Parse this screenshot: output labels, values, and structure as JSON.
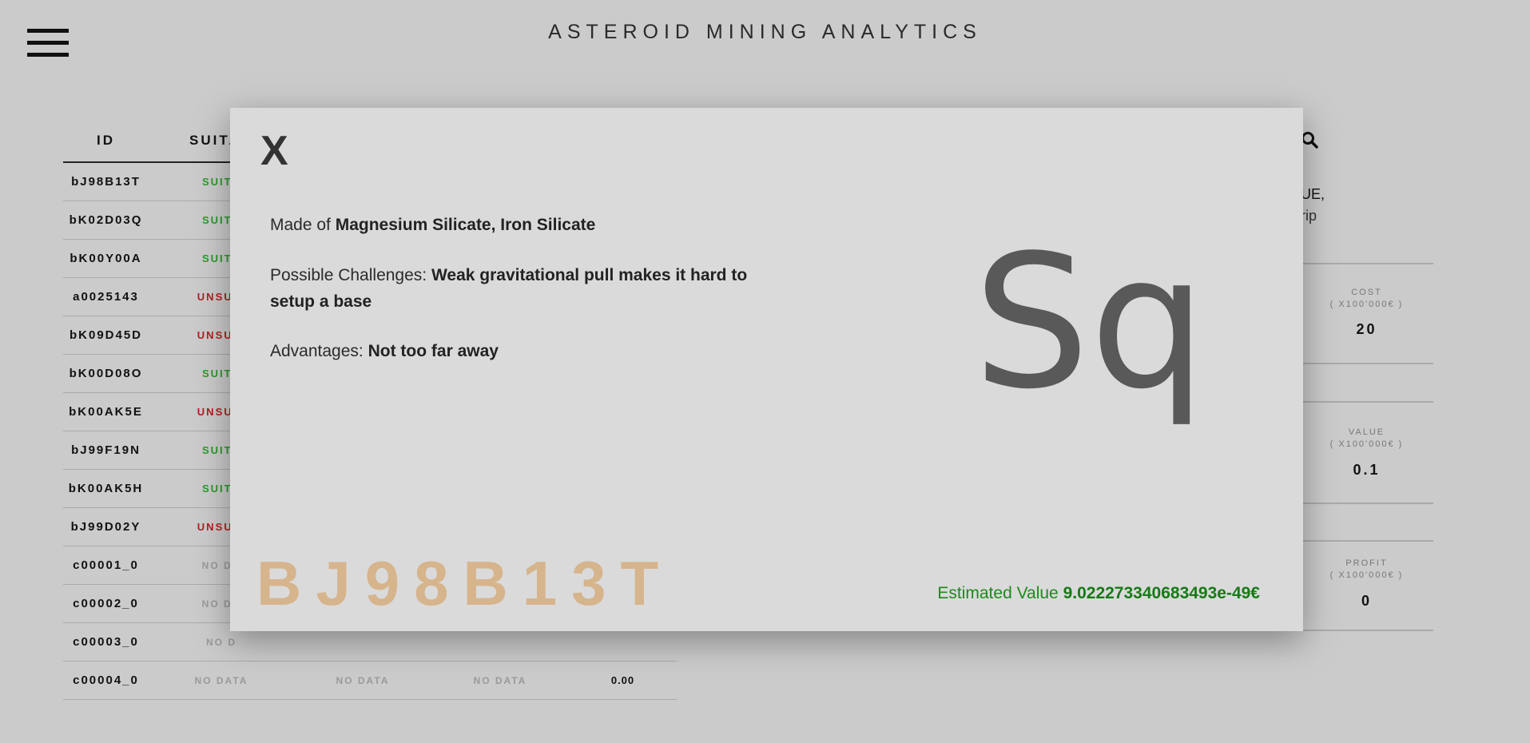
{
  "app": {
    "title": "ASTEROID MINING ANALYTICS"
  },
  "table": {
    "headers": [
      "ID",
      "SUITAB"
    ],
    "rows": [
      {
        "id": "bJ98B13T",
        "status": "SUITA",
        "cls": "s"
      },
      {
        "id": "bK02D03Q",
        "status": "SUITA",
        "cls": "s"
      },
      {
        "id": "bK00Y00A",
        "status": "SUITA",
        "cls": "s"
      },
      {
        "id": "a0025143",
        "status": "UNSUIT",
        "cls": "u"
      },
      {
        "id": "bK09D45D",
        "status": "UNSUIT",
        "cls": "u"
      },
      {
        "id": "bK00D08O",
        "status": "SUITA",
        "cls": "s"
      },
      {
        "id": "bK00AK5E",
        "status": "UNSUIT",
        "cls": "u"
      },
      {
        "id": "bJ99F19N",
        "status": "SUITA",
        "cls": "s"
      },
      {
        "id": "bK00AK5H",
        "status": "SUITA",
        "cls": "s"
      },
      {
        "id": "bJ99D02Y",
        "status": "UNSUIT",
        "cls": "u"
      },
      {
        "id": "c00001_0",
        "status": "NO DA",
        "cls": "n"
      },
      {
        "id": "c00002_0",
        "status": "NO DA",
        "cls": "n"
      },
      {
        "id": "c00003_0",
        "status": "NO D",
        "cls": "n"
      },
      {
        "id": "c00004_0",
        "status": "NO DATA",
        "cls": "n",
        "c3": "NO DATA",
        "c4": "NO DATA",
        "c5": "0.00"
      }
    ]
  },
  "side": {
    "info_line1": "UE,",
    "info_line2": "rip",
    "cost": {
      "label": "COST",
      "unit": "( X100'000€ )",
      "value": "20"
    },
    "value": {
      "label": "VALUE",
      "unit": "( X100'000€ )",
      "value": "0.1"
    },
    "profit": {
      "label": "PROFIT",
      "unit": "( X100'000€ )",
      "value": "0"
    }
  },
  "modal": {
    "close_label": "X",
    "made_of_label": "Made of ",
    "made_of_value": "Magnesium Silicate, Iron Silicate",
    "challenges_label": "Possible Challenges: ",
    "challenges_value": "Weak gravitational pull makes it hard to setup a base",
    "advantages_label": "Advantages: ",
    "advantages_value": "Not too far away",
    "symbol": "Sq",
    "big_id": "BJ98B13T",
    "estimated_label": "Estimated Value ",
    "estimated_value": "9.022273340683493e-49€"
  }
}
